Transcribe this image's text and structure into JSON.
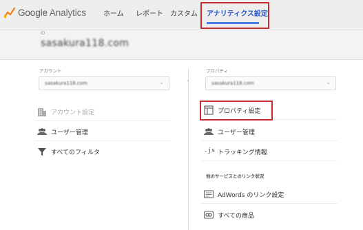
{
  "brand": {
    "name": "Google",
    "product": "Analytics"
  },
  "nav": {
    "tabs": [
      "ホーム",
      "レポート",
      "カスタム",
      "アナリティクス設定"
    ],
    "active": "アナリティクス設定"
  },
  "account_header": {
    "label": "ID",
    "name": "sasakura118.com"
  },
  "account_column": {
    "heading": "アカウント",
    "selector_value": "sasakura118.com",
    "items": [
      {
        "label": "アカウント設定",
        "icon": "building-icon"
      },
      {
        "label": "ユーザー管理",
        "icon": "users-icon"
      },
      {
        "label": "すべてのフィルタ",
        "icon": "filter-icon"
      }
    ]
  },
  "property_column": {
    "heading": "プロパティ",
    "selector_value": "sasakura118.com",
    "items": [
      {
        "label": "プロパティ設定",
        "icon": "property-settings-icon"
      },
      {
        "label": "ユーザー管理",
        "icon": "users-icon"
      },
      {
        "label": "トラッキング情報",
        "icon": "js-icon",
        "icon_text": ".js"
      }
    ],
    "section_heading": "他のサービスとのリンク状況",
    "link_items": [
      {
        "label": "AdWords のリンク設定",
        "icon": "adwords-icon"
      },
      {
        "label": "すべての商品",
        "icon": "link-products-icon"
      }
    ]
  },
  "colors": {
    "accent": "#2a56c6",
    "highlight_box": "#c62b2b",
    "logo_orange": "#f4821f",
    "logo_yellow": "#f9ab00"
  }
}
